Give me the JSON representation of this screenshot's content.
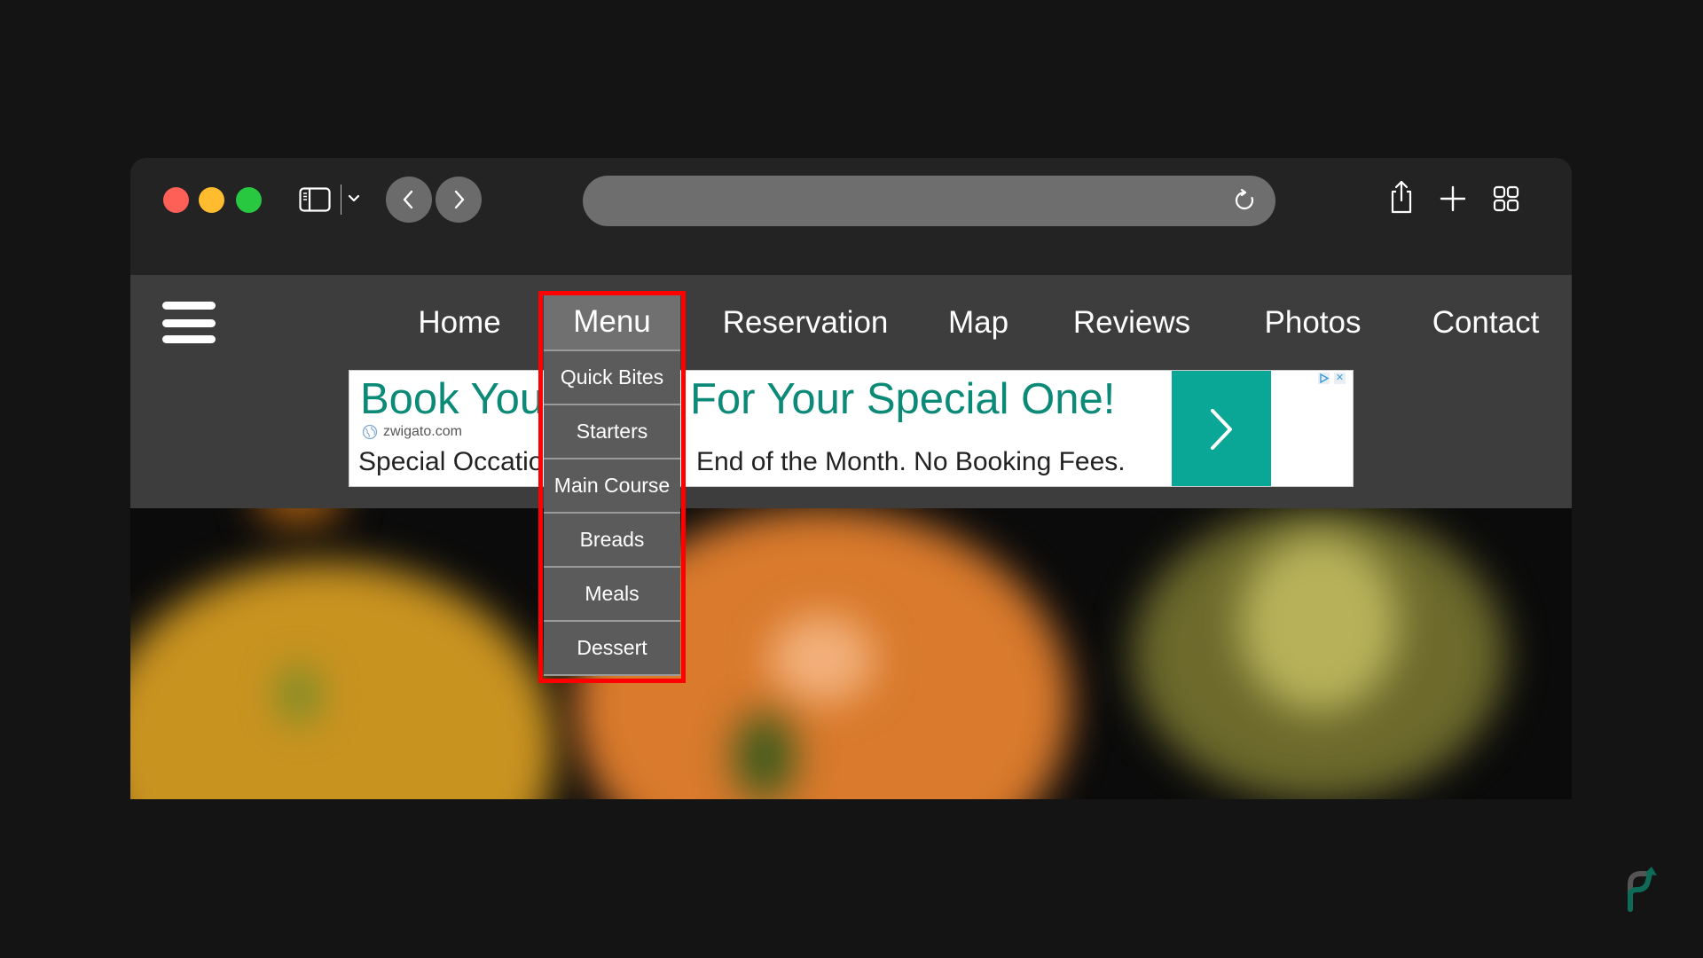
{
  "browser": {
    "traffic_lights": [
      "close",
      "minimize",
      "maximize"
    ],
    "url": "",
    "toolbar_icons": [
      "sidebar-icon",
      "chevron-down-icon",
      "back-icon",
      "forward-icon",
      "reload-icon",
      "share-icon",
      "plus-icon",
      "tab-grid-icon"
    ]
  },
  "site": {
    "nav": {
      "items": [
        {
          "label": "Home"
        },
        {
          "label": "Menu"
        },
        {
          "label": "Reservation"
        },
        {
          "label": "Map"
        },
        {
          "label": "Reviews"
        },
        {
          "label": "Photos"
        },
        {
          "label": "Contact"
        }
      ]
    },
    "menu_dropdown": {
      "header": "Menu",
      "items": [
        {
          "label": "Quick Bites"
        },
        {
          "label": "Starters"
        },
        {
          "label": "Main Course"
        },
        {
          "label": "Breads"
        },
        {
          "label": "Meals"
        },
        {
          "label": "Dessert"
        }
      ],
      "highlight_color": "#ff0000"
    },
    "ad": {
      "title_left": "Book You",
      "title_right": "For Your Special One!",
      "domain": "zwigato.com",
      "desc_left": "Special Occatio",
      "desc_right": "End of the Month. No Booking Fees.",
      "cta_icon": "chevron-right-icon",
      "accent": "#0aa797",
      "title_color": "#0b8a78"
    }
  }
}
